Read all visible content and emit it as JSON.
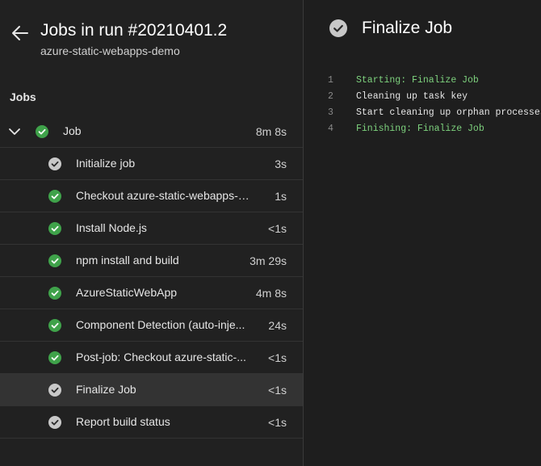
{
  "header": {
    "title": "Jobs in run #20210401.2",
    "subtitle": "azure-static-webapps-demo",
    "back_icon": "arrow-left-icon"
  },
  "jobs_panel": {
    "section_label": "Jobs",
    "job": {
      "name": "Job",
      "duration": "8m 8s",
      "status": "succeeded"
    },
    "steps": [
      {
        "name": "Initialize job",
        "duration": "3s",
        "status": "completed"
      },
      {
        "name": "Checkout azure-static-webapps-d...",
        "duration": "1s",
        "status": "succeeded"
      },
      {
        "name": "Install Node.js",
        "duration": "<1s",
        "status": "succeeded"
      },
      {
        "name": "npm install and build",
        "duration": "3m 29s",
        "status": "succeeded"
      },
      {
        "name": "AzureStaticWebApp",
        "duration": "4m 8s",
        "status": "succeeded"
      },
      {
        "name": "Component Detection (auto-inje...",
        "duration": "24s",
        "status": "succeeded"
      },
      {
        "name": "Post-job: Checkout azure-static-...",
        "duration": "<1s",
        "status": "succeeded"
      },
      {
        "name": "Finalize Job",
        "duration": "<1s",
        "status": "completed",
        "selected": true
      },
      {
        "name": "Report build status",
        "duration": "<1s",
        "status": "completed"
      }
    ]
  },
  "log_panel": {
    "title": "Finalize Job",
    "lines": [
      {
        "num": "1",
        "text": "Starting: Finalize Job",
        "highlight": true
      },
      {
        "num": "2",
        "text": "Cleaning up task key",
        "highlight": false
      },
      {
        "num": "3",
        "text": "Start cleaning up orphan processes.",
        "highlight": false
      },
      {
        "num": "4",
        "text": "Finishing: Finalize Job",
        "highlight": true
      }
    ]
  },
  "colors": {
    "success": "#3fa24a",
    "completed": "#c8c8c8",
    "log_highlight": "#7ed27e",
    "selected_row": "#333333"
  }
}
